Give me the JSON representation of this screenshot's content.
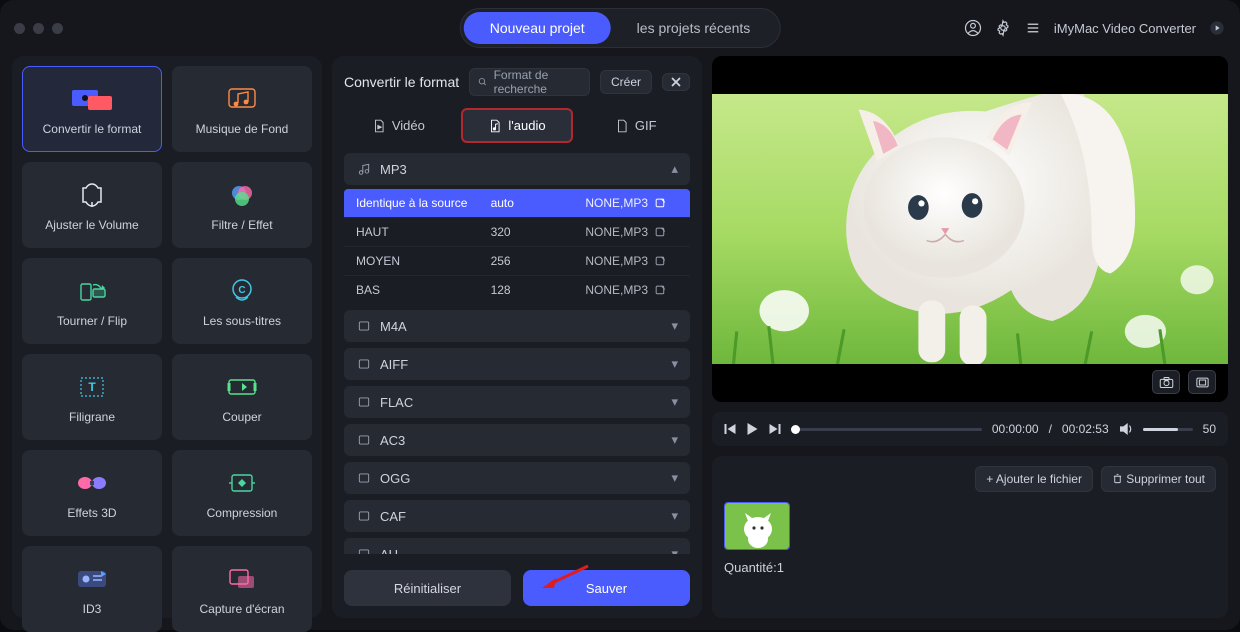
{
  "header": {
    "tabs": {
      "new": "Nouveau projet",
      "recent": "les projets récents"
    },
    "app_name": "iMyMac Video Converter"
  },
  "tools": [
    {
      "id": "convert",
      "label": "Convertir le format"
    },
    {
      "id": "bgmusic",
      "label": "Musique de Fond"
    },
    {
      "id": "volume",
      "label": "Ajuster le Volume"
    },
    {
      "id": "filter",
      "label": "Filtre / Effet"
    },
    {
      "id": "rotate",
      "label": "Tourner / Flip"
    },
    {
      "id": "subtitle",
      "label": "Les sous-titres"
    },
    {
      "id": "watermark",
      "label": "Filigrane"
    },
    {
      "id": "cut",
      "label": "Couper"
    },
    {
      "id": "fx3d",
      "label": "Effets 3D"
    },
    {
      "id": "compress",
      "label": "Compression"
    },
    {
      "id": "id3",
      "label": "ID3"
    },
    {
      "id": "capture",
      "label": "Capture d'écran"
    }
  ],
  "fmt": {
    "title": "Convertir le format",
    "search_placeholder": "Format de recherche",
    "create": "Créer",
    "tabs": {
      "video": "Vidéo",
      "audio": "l'audio",
      "gif": "GIF"
    },
    "active_tab": "audio",
    "expanded_cat": "MP3",
    "categories": [
      "MP3",
      "M4A",
      "AIFF",
      "FLAC",
      "AC3",
      "OGG",
      "CAF",
      "AU"
    ],
    "presets": [
      {
        "name": "Identique à la source",
        "bitrate": "auto",
        "codec": "NONE,MP3",
        "selected": true
      },
      {
        "name": "HAUT",
        "bitrate": "320",
        "codec": "NONE,MP3",
        "selected": false
      },
      {
        "name": "MOYEN",
        "bitrate": "256",
        "codec": "NONE,MP3",
        "selected": false
      },
      {
        "name": "BAS",
        "bitrate": "128",
        "codec": "NONE,MP3",
        "selected": false
      }
    ],
    "reset": "Réinitialiser",
    "save": "Sauver"
  },
  "player": {
    "time_current": "00:00:00",
    "time_total": "00:02:53",
    "volume_value": "50"
  },
  "queue": {
    "add": "Ajouter le fichier",
    "remove_all": "Supprimer tout",
    "count_label": "Quantité:",
    "count_value": "1"
  }
}
